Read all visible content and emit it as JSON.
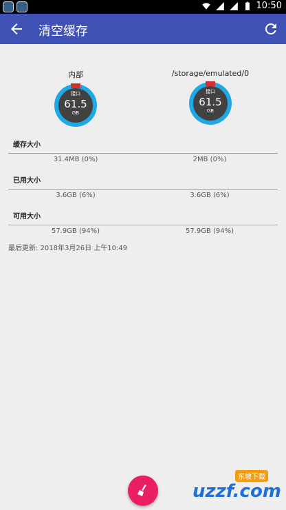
{
  "status_bar": {
    "time": "10:50"
  },
  "header": {
    "title": "清空缓存"
  },
  "storages": [
    {
      "name": "内部",
      "gauge_tag": "接口",
      "gauge_value": "61.5",
      "gauge_unit": "GB"
    },
    {
      "name": "/storage/emulated/0",
      "gauge_tag": "接口",
      "gauge_value": "61.5",
      "gauge_unit": "GB"
    }
  ],
  "sections": {
    "cache": {
      "label": "缓存大小",
      "values": [
        "31.4MB (0%)",
        "2MB (0%)"
      ]
    },
    "used": {
      "label": "已用大小",
      "values": [
        "3.6GB (6%)",
        "3.6GB (6%)"
      ]
    },
    "free": {
      "label": "可用大小",
      "values": [
        "57.9GB (94%)",
        "57.9GB (94%)"
      ]
    }
  },
  "last_updated": "最后更新: 2018年3月26日 上午10:49",
  "watermark": {
    "logo": "uzzf.com",
    "badge": "东坡下载"
  },
  "colors": {
    "app_bar": "#3f51b5",
    "gauge_ring": "#1ea9e6",
    "fab": "#e91e63"
  }
}
